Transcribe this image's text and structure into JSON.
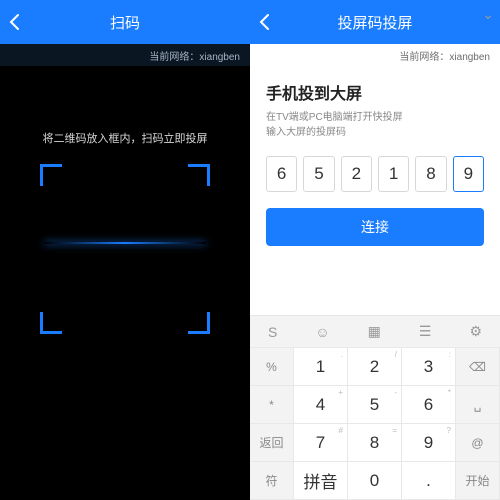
{
  "left": {
    "title": "扫码",
    "network_label": "当前网络：xiangben",
    "scan_message": "将二维码放入框内，扫码立即投屏"
  },
  "right": {
    "title": "投屏码投屏",
    "network_label": "当前网络：xiangben",
    "heading": "手机投到大屏",
    "sub1": "在TV端或PC电脑端打开快投屏",
    "sub2": "输入大屏的投屏码",
    "code": [
      "6",
      "5",
      "2",
      "1",
      "8",
      "9"
    ],
    "connect": "连接",
    "keyboard": {
      "toolbar": [
        "S",
        "☺",
        "▦",
        "☰",
        "⚙",
        "⌄"
      ],
      "rows": [
        {
          "fn": "%",
          "keys": [
            {
              "m": "1",
              "s": "."
            },
            {
              "m": "2",
              "s": "/"
            },
            {
              "m": "3",
              "s": ":"
            }
          ],
          "act": "⌫"
        },
        {
          "fn": "*",
          "keys": [
            {
              "m": "4",
              "s": "+"
            },
            {
              "m": "5",
              "s": "-"
            },
            {
              "m": "6",
              "s": "*"
            }
          ],
          "act": "␣"
        },
        {
          "fn": "返回",
          "keys": [
            {
              "m": "7",
              "s": "#"
            },
            {
              "m": "8",
              "s": "="
            },
            {
              "m": "9",
              "s": "?"
            }
          ],
          "act": "@"
        },
        {
          "fn": "符",
          "keys": [
            {
              "m": "拼音",
              "s": ""
            },
            {
              "m": "0",
              "s": ""
            },
            {
              "m": ".",
              "s": ""
            }
          ],
          "act": "开始"
        }
      ]
    }
  }
}
